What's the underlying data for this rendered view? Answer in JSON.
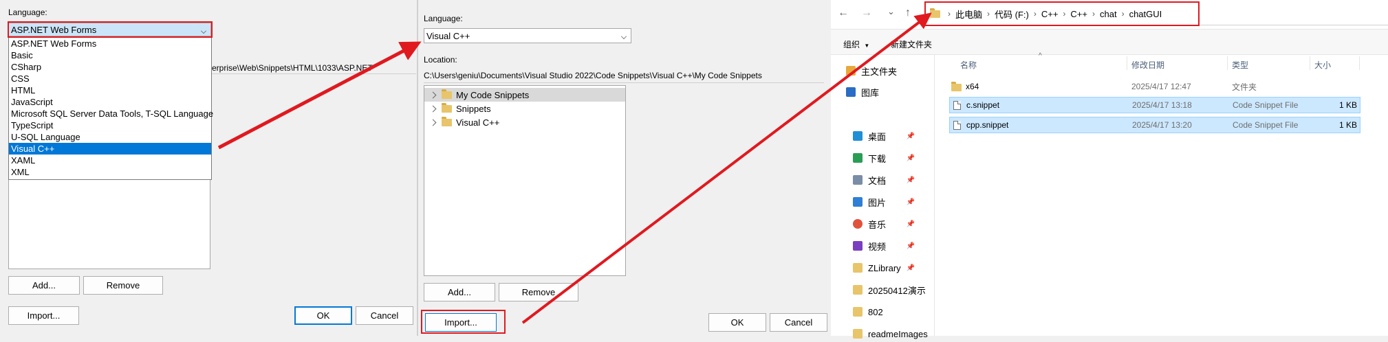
{
  "dialog1": {
    "language_label": "Language:",
    "language_value": "ASP.NET Web Forms",
    "language_options": [
      "ASP.NET Web Forms",
      "Basic",
      "CSharp",
      "CSS",
      "HTML",
      "JavaScript",
      "Microsoft SQL Server Data Tools, T-SQL Language",
      "TypeScript",
      "U-SQL Language",
      "Visual C++",
      "XAML",
      "XML"
    ],
    "selected_option": "Visual C++",
    "location_fragment": "erprise\\Web\\Snippets\\HTML\\1033\\ASP.NET",
    "add_label": "Add...",
    "remove_label": "Remove",
    "import_label": "Import...",
    "ok_label": "OK",
    "cancel_label": "Cancel"
  },
  "dialog2": {
    "language_label": "Language:",
    "language_value": "Visual C++",
    "location_label": "Location:",
    "location_value": "C:\\Users\\geniu\\Documents\\Visual Studio 2022\\Code Snippets\\Visual C++\\My Code Snippets",
    "tree": [
      "My Code Snippets",
      "Snippets",
      "Visual C++"
    ],
    "add_label": "Add...",
    "remove_label": "Remove",
    "import_label": "Import...",
    "ok_label": "OK",
    "cancel_label": "Cancel"
  },
  "explorer": {
    "breadcrumb": [
      "此电脑",
      "代码 (F:)",
      "C++",
      "C++",
      "chat",
      "chatGUI"
    ],
    "organize_label": "组织",
    "new_folder_label": "新建文件夹",
    "sidebar": [
      {
        "label": "主文件夹",
        "icon": "home-icon",
        "color": "#e8a93a",
        "pinned": false
      },
      {
        "label": "图库",
        "icon": "gallery-icon",
        "color": "#2b6cc4",
        "pinned": false
      },
      {
        "label": "桌面",
        "icon": "desktop-icon",
        "color": "#1f8fd6",
        "pinned": true
      },
      {
        "label": "下载",
        "icon": "download-icon",
        "color": "#2a9d55",
        "pinned": true
      },
      {
        "label": "文档",
        "icon": "documents-icon",
        "color": "#7a8da6",
        "pinned": true
      },
      {
        "label": "图片",
        "icon": "pictures-icon",
        "color": "#2f7fd6",
        "pinned": true
      },
      {
        "label": "音乐",
        "icon": "music-icon",
        "color": "#e0523a",
        "pinned": true
      },
      {
        "label": "视频",
        "icon": "video-icon",
        "color": "#7a3fc0",
        "pinned": true
      },
      {
        "label": "ZLibrary",
        "icon": "folder-icon",
        "color": "#e8c56a",
        "pinned": true
      },
      {
        "label": "20250412演示",
        "icon": "folder-icon",
        "color": "#e8c56a",
        "pinned": false
      },
      {
        "label": "802",
        "icon": "folder-icon",
        "color": "#e8c56a",
        "pinned": false
      },
      {
        "label": "readmeImages",
        "icon": "folder-icon",
        "color": "#e8c56a",
        "pinned": false
      }
    ],
    "columns": {
      "name": "名称",
      "modified": "修改日期",
      "type": "类型",
      "size": "大小"
    },
    "files": [
      {
        "name": "x64",
        "modified": "2025/4/17 12:47",
        "type": "文件夹",
        "size": "",
        "kind": "folder",
        "selected": false
      },
      {
        "name": "c.snippet",
        "modified": "2025/4/17 13:18",
        "type": "Code Snippet File",
        "size": "1 KB",
        "kind": "file",
        "selected": true
      },
      {
        "name": "cpp.snippet",
        "modified": "2025/4/17 13:20",
        "type": "Code Snippet File",
        "size": "1 KB",
        "kind": "file",
        "selected": true
      }
    ]
  },
  "colors": {
    "highlight_box": "#e0191f",
    "arrow": "#e0191f",
    "selection": "#0078d7"
  }
}
